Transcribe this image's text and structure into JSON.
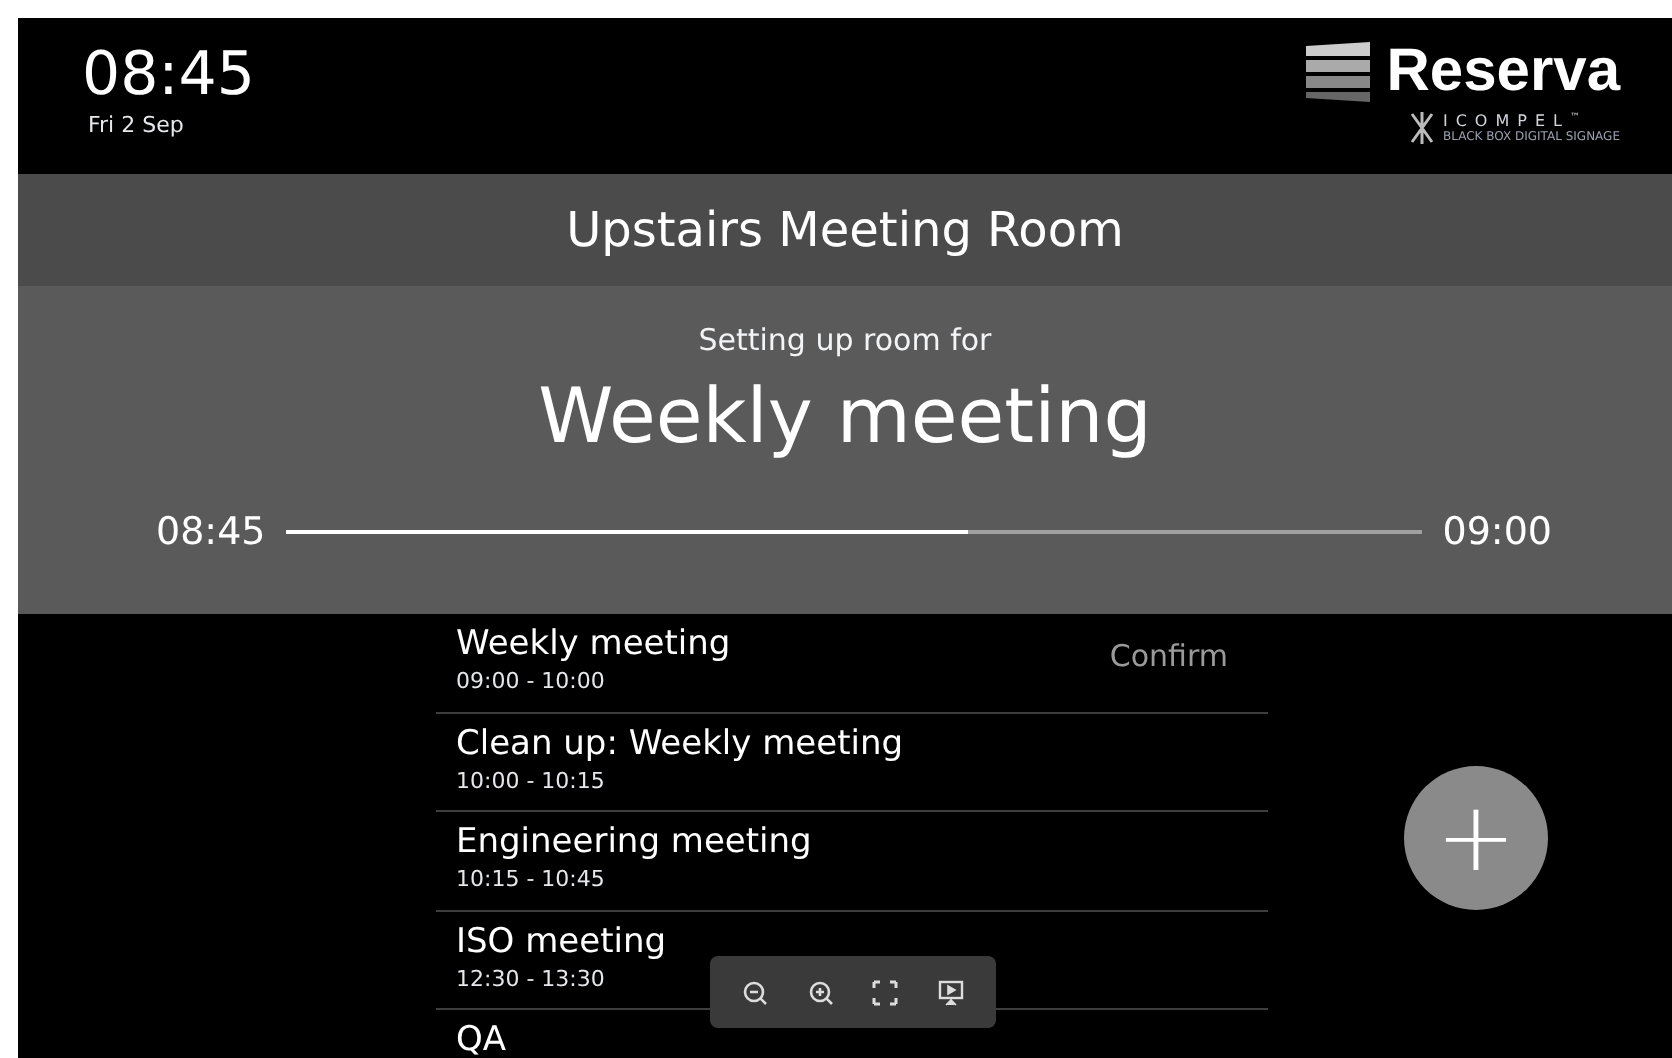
{
  "header": {
    "time": "08:45",
    "date": "Fri 2 Sep"
  },
  "logo": {
    "name": "Reserva",
    "brand": "ICOMPEL",
    "tm": "™",
    "tagline": "BLACK BOX DIGITAL SIGNAGE"
  },
  "room_name": "Upstairs Meeting Room",
  "status": {
    "caption": "Setting up room for",
    "meeting": "Weekly meeting",
    "start": "08:45",
    "end": "09:00",
    "level": 0.6
  },
  "bookings": [
    {
      "title": "Weekly meeting",
      "time": "09:00 - 10:00",
      "action": "Confirm"
    },
    {
      "title": "Clean up: Weekly meeting",
      "time": "10:00 - 10:15"
    },
    {
      "title": "Engineering meeting",
      "time": "10:15 - 10:45"
    },
    {
      "title": "ISO meeting",
      "time": "12:30 - 13:30"
    },
    {
      "title": "QA"
    }
  ],
  "toolbar": [
    {
      "kind": "zoom-out"
    },
    {
      "kind": "zoom-in"
    },
    {
      "kind": "fit"
    },
    {
      "kind": "present"
    }
  ],
  "add_button": {
    "label": "+"
  }
}
